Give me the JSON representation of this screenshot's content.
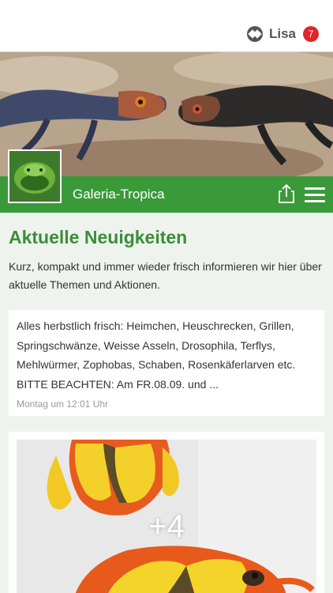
{
  "header": {
    "user_name": "Lisa",
    "notification_count": "7"
  },
  "page": {
    "title": "Galeria-Tropica"
  },
  "news": {
    "heading": "Aktuelle Neuigkeiten",
    "intro": "Kurz, kompakt und immer wieder frisch informieren wir hier über aktuelle Themen und Aktionen.",
    "posts": [
      {
        "text": "Alles herbstlich frisch: Heimchen, Heuschrecken, Grillen, Springschwänze, Weisse Asseln, Drosophila, Terflys, Mehlwürmer, Zophobas, Schaben, Rosenkäferlarven etc. BITTE BEACHTEN: Am FR.08.09. und ...",
        "time": "Montag um 12:01 Uhr"
      },
      {
        "more_photos": "+4"
      }
    ]
  },
  "colors": {
    "accent_green": "#3a9a39",
    "heading_green": "#3a8e39",
    "badge_red": "#e0262b"
  },
  "icons": [
    "app-logo-icon",
    "share-icon",
    "hamburger-menu-icon"
  ]
}
